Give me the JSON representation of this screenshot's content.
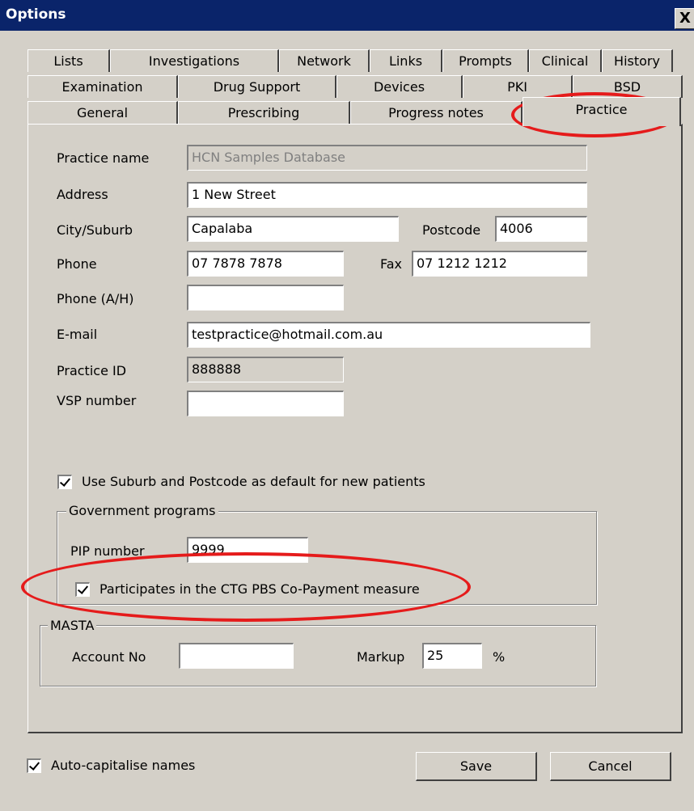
{
  "window": {
    "title": "Options",
    "close_label": "X"
  },
  "tabs": {
    "row1": [
      "Lists",
      "Investigations",
      "Network",
      "Links",
      "Prompts",
      "Clinical",
      "History"
    ],
    "row2": [
      "Examination",
      "Drug Support",
      "Devices",
      "PKI",
      "BSD"
    ],
    "row3": [
      "General",
      "Prescribing",
      "Progress notes",
      "Practice"
    ],
    "active": "Practice"
  },
  "practice": {
    "labels": {
      "practice_name": "Practice name",
      "address": "Address",
      "city": "City/Suburb",
      "postcode": "Postcode",
      "phone": "Phone",
      "fax": "Fax",
      "phone_ah": "Phone (A/H)",
      "email": "E-mail",
      "practice_id": "Practice ID",
      "vsp": "VSP number"
    },
    "values": {
      "practice_name": "HCN Samples Database",
      "address": "1 New Street",
      "city": "Capalaba",
      "postcode": "4006",
      "phone": "07 7878 7878",
      "fax": "07 1212 1212",
      "phone_ah": "",
      "email": "testpractice@hotmail.com.au",
      "practice_id": "888888",
      "vsp": ""
    },
    "use_suburb_default": {
      "label": "Use Suburb and Postcode as default for new patients",
      "checked": true
    }
  },
  "government": {
    "legend": "Government programs",
    "pip_label": "PIP number",
    "pip_value": "9999",
    "ctg": {
      "label": "Participates in the CTG PBS Co-Payment measure",
      "checked": true
    }
  },
  "masta": {
    "legend": "MASTA",
    "account_label": "Account No",
    "account_value": "",
    "markup_label": "Markup",
    "markup_value": "25",
    "percent": "%"
  },
  "footer": {
    "auto_cap": {
      "label": "Auto-capitalise names",
      "checked": true
    },
    "save_label": "Save",
    "cancel_label": "Cancel"
  },
  "colors": {
    "highlight": "#e51b1b",
    "titlebar": "#0a246a",
    "face": "#d4d0c8"
  }
}
